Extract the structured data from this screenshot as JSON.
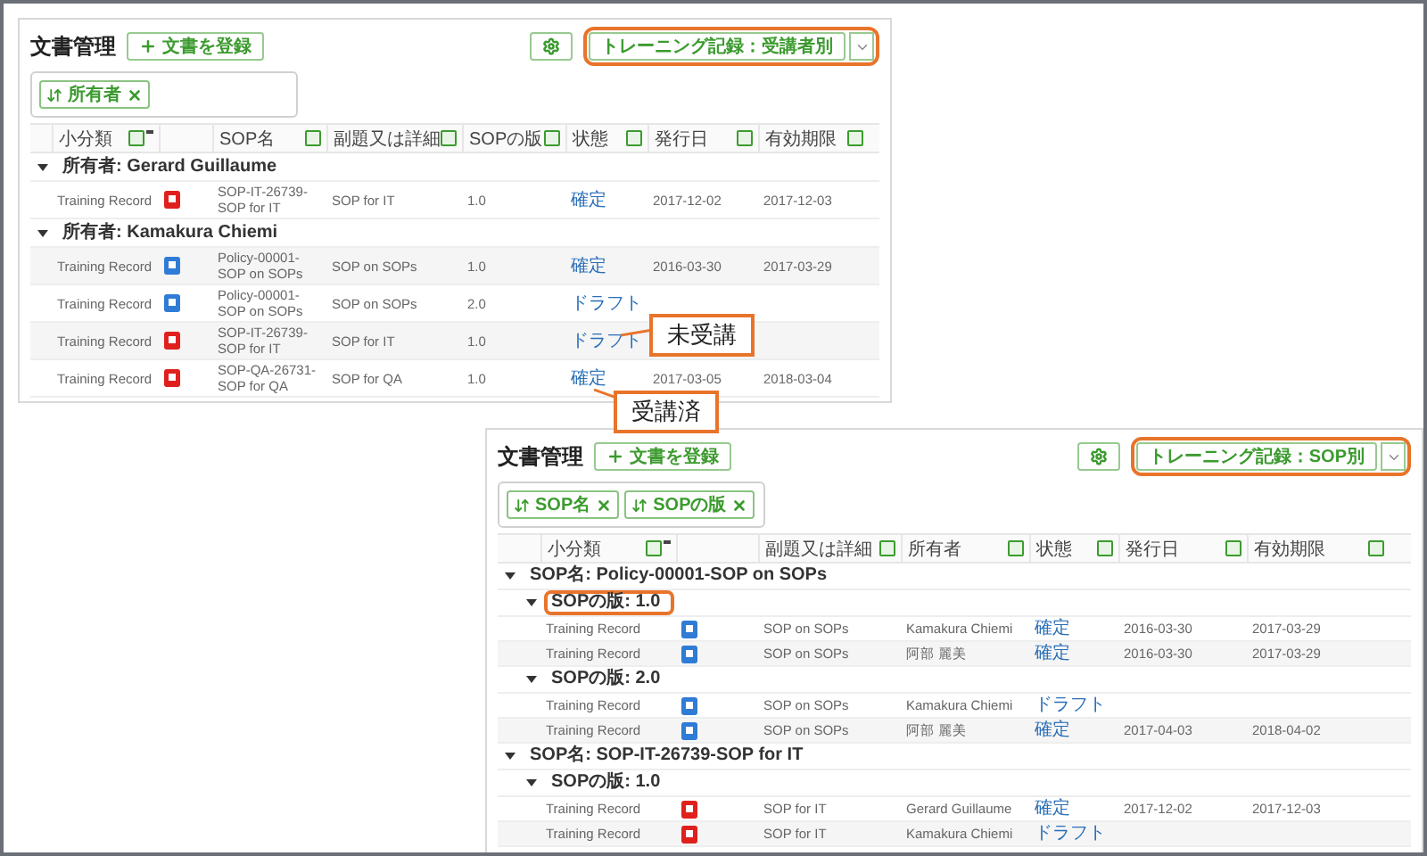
{
  "panels": [
    {
      "title": "文書管理",
      "register_button": "文書を登録",
      "filters": [
        "所有者"
      ],
      "view_button": {
        "label": "トレーニング記録：受講者別",
        "highlighted": true
      },
      "columns": [
        {
          "kind": "text",
          "label": "小分類",
          "filtered": true
        },
        {
          "kind": "icon"
        },
        {
          "kind": "text",
          "label": "SOP名",
          "filtered": false
        },
        {
          "kind": "text",
          "label": "副題又は詳細",
          "filtered": false
        },
        {
          "kind": "text",
          "label": "SOPの版",
          "filtered": false
        },
        {
          "kind": "status",
          "label": "状態",
          "filtered": false
        },
        {
          "kind": "text",
          "label": "発行日",
          "filtered": false
        },
        {
          "kind": "text",
          "label": "有効期限",
          "filtered": false
        }
      ],
      "groups": [
        {
          "label": "所有者: Gerard Guillaume",
          "highlighted": false,
          "rows": [
            {
              "kind": "pdf",
              "cells": [
                "Training Record",
                "SOP-IT-26739-SOP for IT",
                "SOP for IT",
                "1.0",
                "確定",
                "2017-12-02",
                "2017-12-03"
              ]
            }
          ]
        },
        {
          "label": "所有者: Kamakura Chiemi",
          "highlighted": false,
          "rows": [
            {
              "kind": "word",
              "cells": [
                "Training Record",
                "Policy-00001-SOP on SOPs",
                "SOP on SOPs",
                "1.0",
                "確定",
                "2016-03-30",
                "2017-03-29"
              ]
            },
            {
              "kind": "word",
              "cells": [
                "Training Record",
                "Policy-00001-SOP on SOPs",
                "SOP on SOPs",
                "2.0",
                "ドラフト"
              ]
            },
            {
              "kind": "pdf",
              "cells": [
                "Training Record",
                "SOP-IT-26739-SOP for IT",
                "SOP for IT",
                "1.0",
                "ドラフト"
              ]
            },
            {
              "kind": "pdf",
              "cells": [
                "Training Record",
                "SOP-QA-26731-SOP for QA",
                "SOP for QA",
                "1.0",
                "確定",
                "2017-03-05",
                "2018-03-04"
              ]
            }
          ]
        }
      ]
    },
    {
      "title": "文書管理",
      "register_button": "文書を登録",
      "filters": [
        "SOP名",
        "SOPの版"
      ],
      "view_button": {
        "label": "トレーニング記録：SOP別",
        "highlighted": true
      },
      "columns": [
        {
          "kind": "text",
          "label": "小分類",
          "filtered": true
        },
        {
          "kind": "icon"
        },
        {
          "kind": "text",
          "label": "副題又は詳細",
          "filtered": false
        },
        {
          "kind": "text",
          "label": "所有者",
          "filtered": false
        },
        {
          "kind": "status",
          "label": "状態",
          "filtered": false
        },
        {
          "kind": "text",
          "label": "発行日",
          "filtered": false
        },
        {
          "kind": "text",
          "label": "有効期限",
          "filtered": false
        }
      ],
      "groups": [
        {
          "label": "SOP名: Policy-00001-SOP on SOPs",
          "highlighted": false,
          "children": [
            {
              "label": "SOPの版: 1.0",
              "highlighted": true,
              "rows": [
                {
                  "kind": "word",
                  "cells": [
                    "Training Record",
                    "SOP on SOPs",
                    "Kamakura Chiemi",
                    "確定",
                    "2016-03-30",
                    "2017-03-29"
                  ]
                },
                {
                  "kind": "word",
                  "cells": [
                    "Training Record",
                    "SOP on SOPs",
                    "阿部 麗美",
                    "確定",
                    "2016-03-30",
                    "2017-03-29"
                  ]
                }
              ]
            },
            {
              "label": "SOPの版: 2.0",
              "highlighted": false,
              "rows": [
                {
                  "kind": "word",
                  "cells": [
                    "Training Record",
                    "SOP on SOPs",
                    "Kamakura Chiemi",
                    "ドラフト"
                  ]
                },
                {
                  "kind": "word",
                  "cells": [
                    "Training Record",
                    "SOP on SOPs",
                    "阿部 麗美",
                    "確定",
                    "2017-04-03",
                    "2018-04-02"
                  ]
                }
              ]
            }
          ]
        },
        {
          "label": "SOP名: SOP-IT-26739-SOP for IT",
          "highlighted": false,
          "children": [
            {
              "label": "SOPの版: 1.0",
              "highlighted": false,
              "rows": [
                {
                  "kind": "pdf",
                  "cells": [
                    "Training Record",
                    "SOP for IT",
                    "Gerard Guillaume",
                    "確定",
                    "2017-12-02",
                    "2017-12-03"
                  ]
                },
                {
                  "kind": "pdf",
                  "cells": [
                    "Training Record",
                    "SOP for IT",
                    "Kamakura Chiemi",
                    "ドラフト"
                  ]
                }
              ]
            }
          ]
        }
      ]
    }
  ],
  "callouts": [
    {
      "text": "未受講"
    },
    {
      "text": "受講済"
    }
  ]
}
